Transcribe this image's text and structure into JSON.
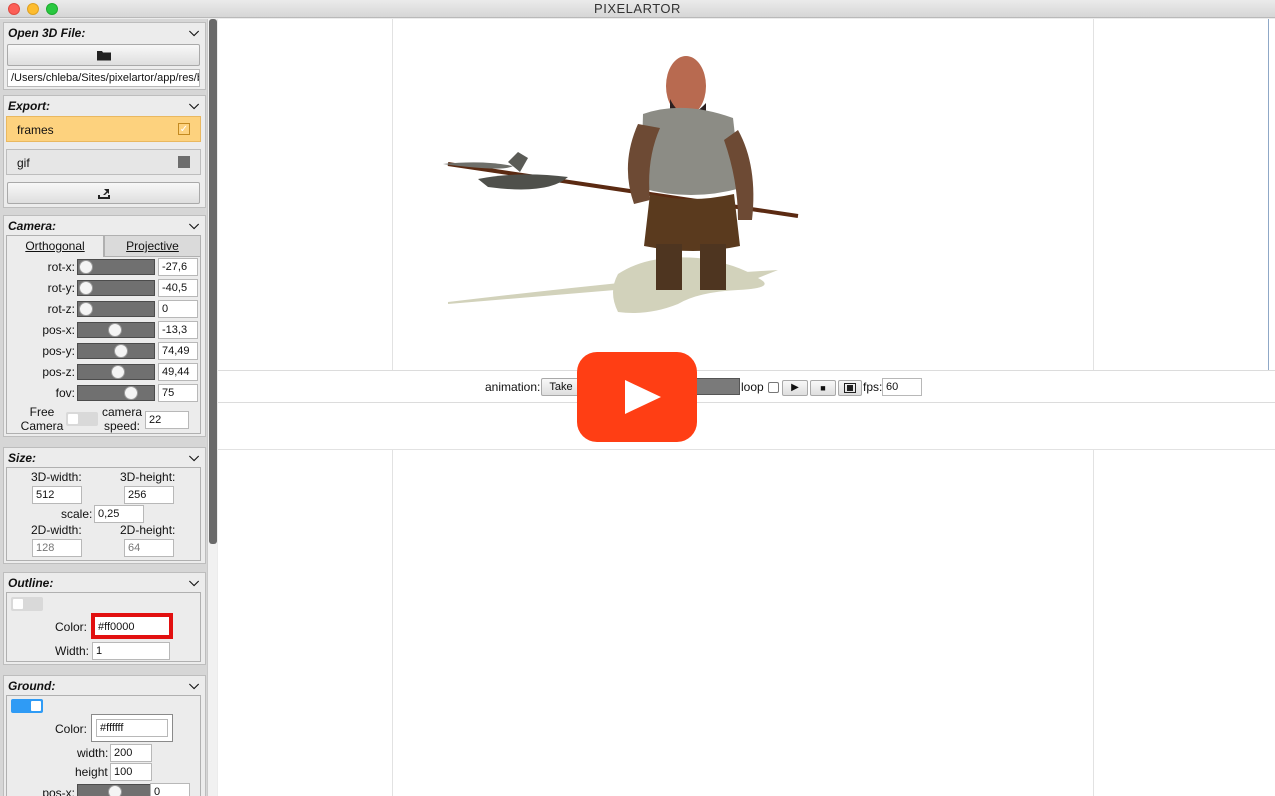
{
  "window": {
    "title": "PIXELARTOR"
  },
  "open_file": {
    "header": "Open 3D File:",
    "path": "/Users/chleba/Sites/pixelartor/app/res/b"
  },
  "export": {
    "header": "Export:",
    "items": [
      {
        "label": "frames",
        "checked": true
      },
      {
        "label": "gif",
        "checked": false
      }
    ]
  },
  "camera": {
    "header": "Camera:",
    "tabs": [
      "Orthogonal",
      "Projective"
    ],
    "rows": [
      {
        "label": "rot-x:",
        "value": "-27,6"
      },
      {
        "label": "rot-y:",
        "value": "-40,5"
      },
      {
        "label": "rot-z:",
        "value": "0"
      },
      {
        "label": "pos-x:",
        "value": "-13,3"
      },
      {
        "label": "pos-y:",
        "value": "74,49"
      },
      {
        "label": "pos-z:",
        "value": "49,44"
      },
      {
        "label": "fov:",
        "value": "75"
      }
    ],
    "free_camera_label": "Free\nCamera",
    "camera_speed_label": "camera\nspeed:",
    "camera_speed": "22"
  },
  "size": {
    "header": "Size:",
    "width3d_label": "3D-width:",
    "width3d": "512",
    "height3d_label": "3D-height:",
    "height3d": "256",
    "scale_label": "scale:",
    "scale": "0,25",
    "width2d_label": "2D-width:",
    "width2d": "128",
    "height2d_label": "2D-height:",
    "height2d": "64"
  },
  "outline": {
    "header": "Outline:",
    "color_label": "Color:",
    "color": "#ff0000",
    "width_label": "Width:",
    "width": "1"
  },
  "ground": {
    "header": "Ground:",
    "color_label": "Color:",
    "color": "#ffffff",
    "width_label": "width:",
    "width": "200",
    "height_label": "height",
    "height": "100",
    "posx_label": "pos-x:",
    "posx": "0"
  },
  "animation": {
    "label": "animation:",
    "select": "Take",
    "loop_label": "loop",
    "fps_label": "fps:",
    "fps": "60"
  },
  "colors": {
    "accent_highlight": "#fdd27e",
    "toggle_on": "#2f9bf5",
    "outline_border": "#e21010",
    "play_overlay": "#ff3e14"
  },
  "icons": [
    "folder-icon",
    "export-icon",
    "chevron-down-icon",
    "play-icon",
    "stop-icon",
    "film-icon",
    "youtube-play-icon"
  ]
}
